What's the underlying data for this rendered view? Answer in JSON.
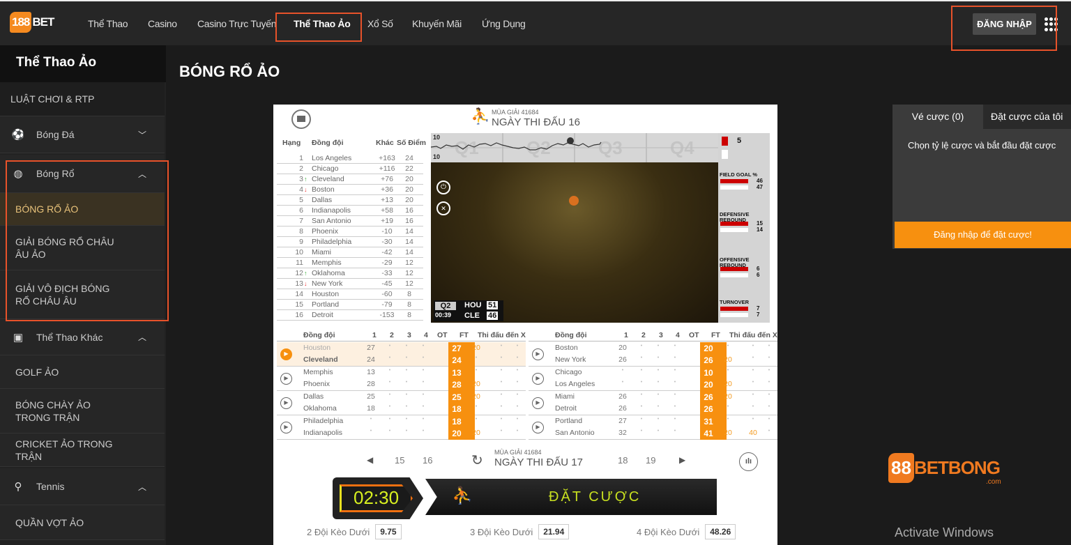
{
  "header": {
    "logo_num": "188",
    "logo_text": "BET",
    "nav": [
      "Thể Thao",
      "Casino",
      "Casino Trực Tuyến",
      "Thể Thao Ảo",
      "Xổ Số",
      "Khuyến Mãi",
      "Ứng Dụng"
    ],
    "active_nav": "Thể Thao Ảo",
    "login": "ĐĂNG NHẬP"
  },
  "sidebar": {
    "title": "Thể Thao Ảo",
    "items": [
      {
        "label": "LUẬT CHƠI & RTP",
        "type": "link"
      },
      {
        "label": "Bóng Đá",
        "type": "cat",
        "icon": "soccer-ball-icon",
        "expanded": false
      },
      {
        "label": "Bóng Rổ",
        "type": "cat",
        "icon": "basketball-icon",
        "expanded": true
      },
      {
        "label": "BÓNG RỔ ẢO",
        "type": "sub",
        "selected": true
      },
      {
        "label": "GIẢI BÓNG RỔ CHÂU ÂU ẢO",
        "type": "sub"
      },
      {
        "label": "GIẢI VÔ ĐỊCH BÓNG RỔ CHÂU ÂU",
        "type": "sub"
      },
      {
        "label": "Thể Thao Khác",
        "type": "cat",
        "icon": "monitor-icon",
        "expanded": true
      },
      {
        "label": "GOLF ẢO",
        "type": "sub"
      },
      {
        "label": "BÓNG CHÀY ẢO TRONG TRẬN",
        "type": "sub"
      },
      {
        "label": "CRICKET ẢO TRONG TRẬN",
        "type": "sub"
      },
      {
        "label": "Tennis",
        "type": "cat",
        "icon": "tennis-racket-icon",
        "expanded": true
      },
      {
        "label": "QUẦN VỢT ẢO",
        "type": "sub"
      }
    ]
  },
  "page_title": "BÓNG RỔ ẢO",
  "game": {
    "season": "MÙA GIẢI 41684",
    "matchday": "NGÀY THI ĐẤU 16",
    "standings_headers": [
      "Hạng",
      "Đồng đội",
      "Khác",
      "Số Điểm"
    ],
    "standings": [
      [
        "1",
        "Los Angeles",
        "+163",
        "24",
        ""
      ],
      [
        "2",
        "Chicago",
        "+116",
        "22",
        ""
      ],
      [
        "3",
        "Cleveland",
        "+76",
        "20",
        "up"
      ],
      [
        "4",
        "Boston",
        "+36",
        "20",
        "down"
      ],
      [
        "5",
        "Dallas",
        "+13",
        "20",
        ""
      ],
      [
        "6",
        "Indianapolis",
        "+58",
        "16",
        ""
      ],
      [
        "7",
        "San Antonio",
        "+19",
        "16",
        ""
      ],
      [
        "8",
        "Phoenix",
        "-10",
        "14",
        ""
      ],
      [
        "9",
        "Philadelphia",
        "-30",
        "14",
        ""
      ],
      [
        "10",
        "Miami",
        "-42",
        "14",
        ""
      ],
      [
        "11",
        "Memphis",
        "-29",
        "12",
        ""
      ],
      [
        "12",
        "Oklahoma",
        "-33",
        "12",
        "up"
      ],
      [
        "13",
        "New York",
        "-45",
        "12",
        "down"
      ],
      [
        "14",
        "Houston",
        "-60",
        "8",
        ""
      ],
      [
        "15",
        "Portland",
        "-79",
        "8",
        ""
      ],
      [
        "16",
        "Detroit",
        "-153",
        "8",
        ""
      ]
    ],
    "chart_labels": {
      "top": "10",
      "bottom": "10",
      "quarters": [
        "Q1",
        "Q2",
        "Q3",
        "Q4"
      ]
    },
    "scoreboard": {
      "quarter": "Q2",
      "clock": "00:39",
      "home": "HOU",
      "home_score": "51",
      "away": "CLE",
      "away_score": "46"
    },
    "stats": {
      "fouls": "5",
      "items": [
        {
          "label": "FIELD GOAL %",
          "a": "46",
          "b": "47"
        },
        {
          "label": "DEFENSIVE REBOUND",
          "a": "15",
          "b": "14"
        },
        {
          "label": "OFFENSIVE REBOUND",
          "a": "6",
          "b": "6"
        },
        {
          "label": "TURNOVER",
          "a": "7",
          "b": "7"
        }
      ]
    },
    "results_headers": [
      "Đồng đội",
      "1",
      "2",
      "3",
      "4",
      "OT",
      "FT",
      "Thi đấu đến X"
    ],
    "matches_left": [
      {
        "live": true,
        "teams": [
          [
            "Houston",
            "27",
            "•",
            "•",
            "•",
            "",
            "27",
            "20",
            "•",
            "•"
          ],
          [
            "Cleveland",
            "24",
            "•",
            "•",
            "•",
            "",
            "24",
            "•",
            "•",
            "•"
          ]
        ]
      },
      {
        "teams": [
          [
            "Memphis",
            "13",
            "•",
            "•",
            "•",
            "",
            "13",
            "•",
            "•",
            "•"
          ],
          [
            "Phoenix",
            "28",
            "•",
            "•",
            "•",
            "",
            "28",
            "20",
            "•",
            "•"
          ]
        ]
      },
      {
        "teams": [
          [
            "Dallas",
            "25",
            "•",
            "•",
            "•",
            "",
            "25",
            "20",
            "•",
            "•"
          ],
          [
            "Oklahoma",
            "18",
            "•",
            "•",
            "•",
            "",
            "18",
            "•",
            "•",
            "•"
          ]
        ]
      },
      {
        "teams": [
          [
            "Philadelphia",
            "•",
            "•",
            "•",
            "•",
            "",
            "18",
            "•",
            "•",
            "•"
          ],
          [
            "Indianapolis",
            "•",
            "•",
            "•",
            "•",
            "",
            "20",
            "20",
            "•",
            "•"
          ]
        ]
      }
    ],
    "matches_right": [
      {
        "teams": [
          [
            "Boston",
            "20",
            "•",
            "•",
            "•",
            "",
            "20",
            "•",
            "•",
            "•"
          ],
          [
            "New York",
            "26",
            "•",
            "•",
            "•",
            "",
            "26",
            "20",
            "•",
            "•"
          ]
        ]
      },
      {
        "teams": [
          [
            "Chicago",
            "•",
            "•",
            "•",
            "•",
            "",
            "10",
            "•",
            "•",
            "•"
          ],
          [
            "Los Angeles",
            "•",
            "•",
            "•",
            "•",
            "",
            "20",
            "20",
            "•",
            "•"
          ]
        ]
      },
      {
        "teams": [
          [
            "Miami",
            "26",
            "•",
            "•",
            "•",
            "",
            "26",
            "20",
            "•",
            "•"
          ],
          [
            "Detroit",
            "26",
            "•",
            "•",
            "•",
            "",
            "26",
            "•",
            "•",
            "•"
          ]
        ]
      },
      {
        "teams": [
          [
            "Portland",
            "27",
            "•",
            "•",
            "•",
            "",
            "31",
            "•",
            "•",
            "•"
          ],
          [
            "San Antonio",
            "32",
            "•",
            "•",
            "•",
            "",
            "41",
            "20",
            "40",
            "•"
          ]
        ]
      }
    ],
    "pager": {
      "prev": [
        "15",
        "16"
      ],
      "season": "MÙA GIẢI 41684",
      "matchday": "NGÀY THI ĐẤU 17",
      "next": [
        "18",
        "19"
      ]
    },
    "countdown": "02:30",
    "bet_label": "ĐẶT CƯỢC",
    "odds": [
      {
        "label": "2 Đội Kèo Dưới",
        "value": "9.75"
      },
      {
        "label": "3 Đội Kèo Dưới",
        "value": "21.94"
      },
      {
        "label": "4 Đội Kèo Dưới",
        "value": "48.26"
      }
    ]
  },
  "betslip": {
    "tabs": [
      "Vé cược (0)",
      "Đặt cược của tôi"
    ],
    "message": "Chọn tỷ lệ cược và bắt đầu đặt cược",
    "login_button": "Đăng nhập để đặt cược!"
  },
  "watermark": {
    "logo_num": "88",
    "logo_text": "BETBONG",
    "logo_sub": ".com"
  },
  "os_notice": "Activate Windows",
  "colors": {
    "accent": "#f7900f",
    "header_bg": "#262626",
    "highlight": "#e8522a"
  }
}
